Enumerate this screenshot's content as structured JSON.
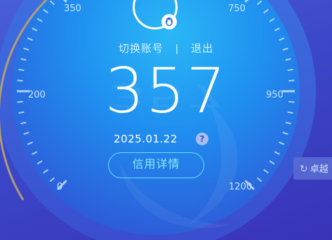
{
  "gauge": {
    "labels": {
      "l0": "0",
      "l200": "200",
      "l350": "350",
      "l750": "750",
      "l950": "950",
      "l1200": "1200"
    }
  },
  "header": {
    "switch_account": "切换账号",
    "separator": "|",
    "logout": "退出"
  },
  "score": {
    "value": "357",
    "date": "2025.01.22",
    "help_icon": "?"
  },
  "credit_button": {
    "label": "信用详情"
  },
  "side_tab": {
    "label": "卓越"
  },
  "colors": {
    "accent_cyan": "#5fe0ff",
    "dial_blue": "#1f8ff0",
    "background": "#3b47c8"
  }
}
